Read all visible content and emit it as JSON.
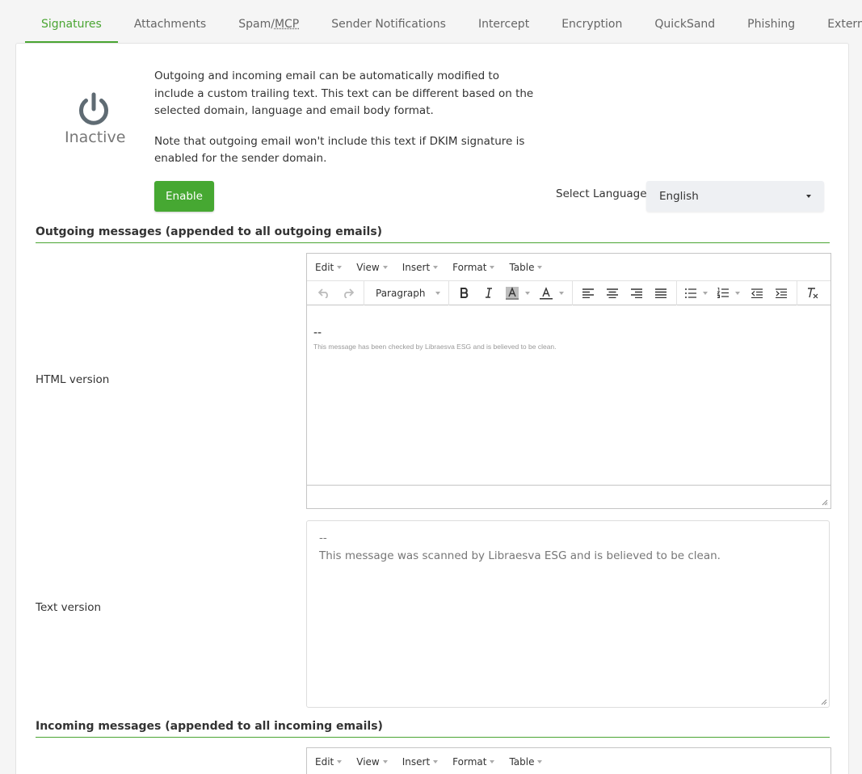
{
  "tabs": [
    {
      "label": "Signatures",
      "active": true
    },
    {
      "label": "Attachments"
    },
    {
      "label_before": "Spam/",
      "label_abbr": "MCP"
    },
    {
      "label": "Sender Notifications"
    },
    {
      "label": "Intercept"
    },
    {
      "label": "Encryption"
    },
    {
      "label": "QuickSand"
    },
    {
      "label": "Phishing"
    },
    {
      "label": "External"
    }
  ],
  "status": {
    "label": "Inactive",
    "icon": "power-icon",
    "color": "#5f6b73"
  },
  "description": {
    "p1": "Outgoing and incoming email can be automatically modified to include a custom trailing text. This text can be different based on the selected domain, language and email body format.",
    "p2": "Note that outgoing email won't include this text if DKIM signature is enabled for the sender domain."
  },
  "enable_button": {
    "label": "Enable",
    "color": "#46a832"
  },
  "language": {
    "label": "Select Language",
    "value": "English"
  },
  "outgoing": {
    "title": "Outgoing messages (appended to all outgoing emails)",
    "html_label": "HTML version",
    "text_label": "Text version",
    "html_content": {
      "dash": "--",
      "body": "This message has been checked by Libraesva ESG and is believed to be clean."
    },
    "text_content": {
      "dash": "--",
      "body": "This message was scanned by Libraesva ESG and is believed to be clean."
    }
  },
  "incoming": {
    "title": "Incoming messages (appended to all incoming emails)"
  },
  "editor": {
    "menus": [
      "Edit",
      "View",
      "Insert",
      "Format",
      "Table"
    ],
    "block_format": "Paragraph"
  },
  "accent_color": "#4aa532"
}
